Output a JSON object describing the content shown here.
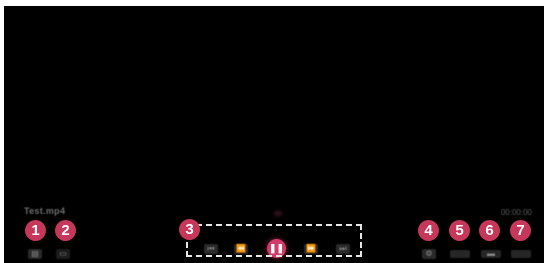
{
  "player": {
    "file_name": "Test.mp4",
    "time_readout": "00:00:00"
  },
  "controls": {
    "left": [
      {
        "name": "playlist-button",
        "glyph": "▤"
      },
      {
        "name": "subtitle-button",
        "glyph": "▭"
      }
    ],
    "center": [
      {
        "name": "previous-button",
        "glyph": "⏮"
      },
      {
        "name": "rewind-button",
        "glyph": "⏪"
      },
      {
        "name": "play-pause-button",
        "glyph": "❚❚"
      },
      {
        "name": "fast-forward-button",
        "glyph": "⏩"
      },
      {
        "name": "next-button",
        "glyph": "⏭"
      }
    ],
    "right": [
      {
        "name": "settings-button",
        "glyph": "⚙"
      },
      {
        "name": "repeat-button",
        "glyph": ""
      },
      {
        "name": "more-options-button",
        "glyph": "▬"
      },
      {
        "name": "close-button",
        "glyph": ""
      }
    ]
  },
  "callouts": [
    "1",
    "2",
    "3",
    "4",
    "5",
    "6",
    "7"
  ],
  "colors": {
    "background": "#000000",
    "accent": "#d23a6a",
    "badge": "#c6375a",
    "highlight_border": "#e6e6e6"
  }
}
